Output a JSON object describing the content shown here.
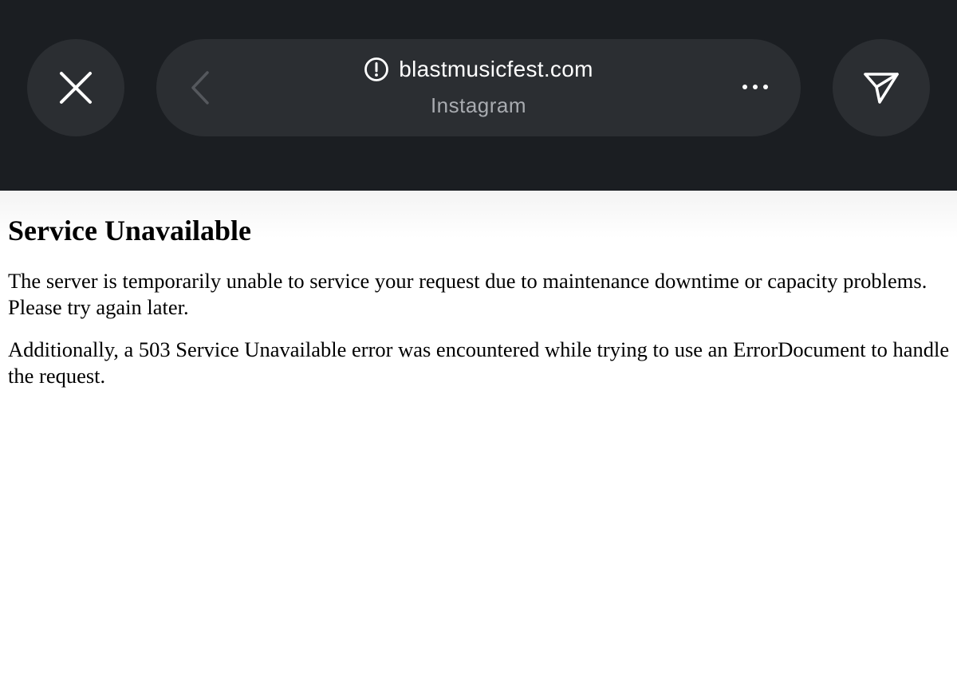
{
  "browser": {
    "domain": "blastmusicfest.com",
    "source_app": "Instagram",
    "icons": {
      "close": "close-icon",
      "back": "chevron-left-icon",
      "warning": "alert-circle-icon",
      "more": "more-horizontal-icon",
      "share": "send-icon"
    },
    "colors": {
      "toolbar_bg": "#1b1e22",
      "button_bg": "#2b2e32"
    }
  },
  "page": {
    "title": "Service Unavailable",
    "paragraphs": [
      "The server is temporarily unable to service your request due to maintenance downtime or capacity problems. Please try again later.",
      "Additionally, a 503 Service Unavailable error was encountered while trying to use an ErrorDocument to handle the request."
    ]
  }
}
